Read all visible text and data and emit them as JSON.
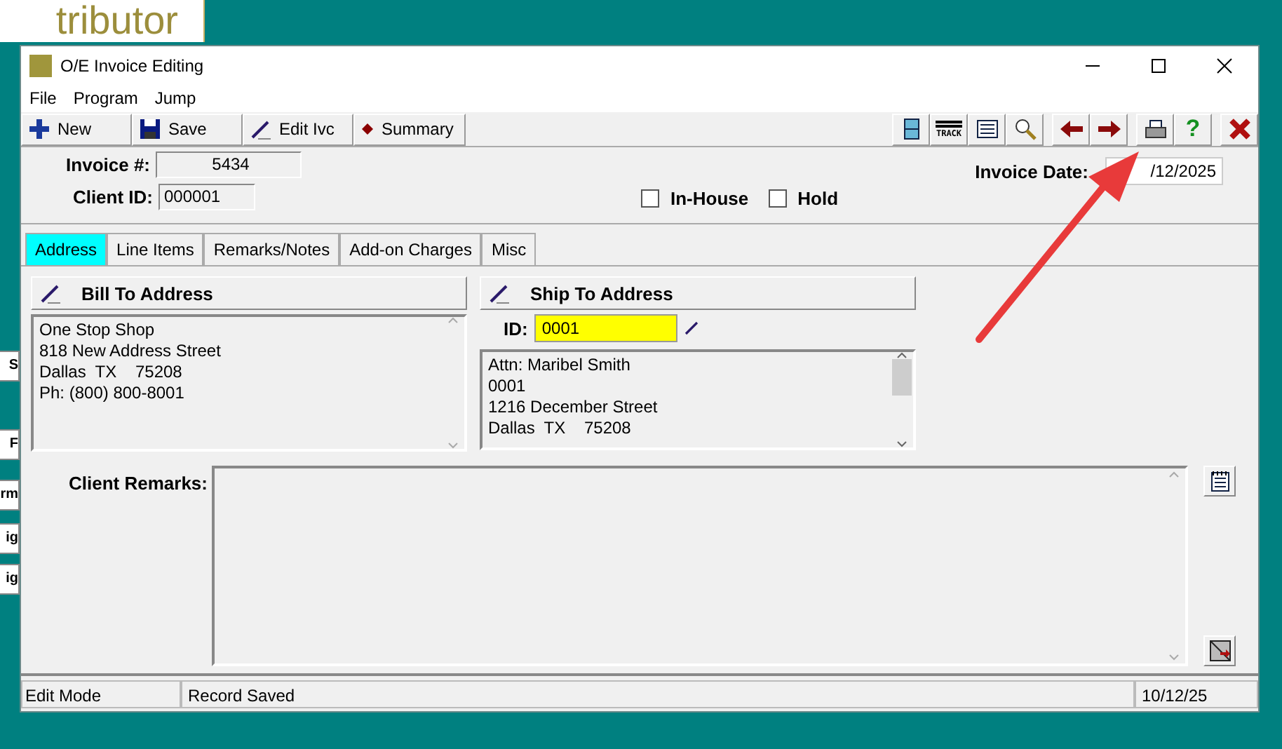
{
  "desktop": {
    "logo_text": "tributor",
    "background_buttons": [
      "S",
      "F",
      "rm",
      "ig",
      "ig"
    ]
  },
  "window": {
    "title": "O/E Invoice Editing"
  },
  "menu": [
    "File",
    "Program",
    "Jump"
  ],
  "toolbar_left": [
    {
      "label": "New",
      "kind": "new"
    },
    {
      "label": "Save",
      "kind": "save"
    },
    {
      "label": "Edit Ivc",
      "kind": "edit"
    },
    {
      "label": "Summary",
      "kind": "summary"
    }
  ],
  "toolbar_right": [
    {
      "kind": "cabinet"
    },
    {
      "kind": "track",
      "label": "TRACK"
    },
    {
      "kind": "list"
    },
    {
      "kind": "search"
    },
    {
      "kind": "back"
    },
    {
      "kind": "forward"
    },
    {
      "kind": "print"
    },
    {
      "kind": "help",
      "label": "?"
    },
    {
      "kind": "close"
    }
  ],
  "header": {
    "invoice_label": "Invoice #:",
    "invoice_value": "5434",
    "client_label": "Client ID:",
    "client_value": "000001",
    "checkboxes": [
      {
        "label": "In-House",
        "checked": false
      },
      {
        "label": "Hold",
        "checked": false
      }
    ],
    "date_label": "Invoice Date:",
    "date_value": "/12/2025"
  },
  "tabs": [
    {
      "label": "Address",
      "selected": true
    },
    {
      "label": "Line Items",
      "selected": false
    },
    {
      "label": "Remarks/Notes",
      "selected": false
    },
    {
      "label": "Add-on Charges",
      "selected": false
    },
    {
      "label": "Misc",
      "selected": false
    }
  ],
  "bill_to": {
    "title": "Bill To Address",
    "lines": [
      "One Stop Shop",
      "818 New Address Street",
      "Dallas  TX    75208",
      "Ph: (800) 800-8001"
    ]
  },
  "ship_to": {
    "title": "Ship To Address",
    "id_label": "ID:",
    "id_value": "0001",
    "lines": [
      "Attn: Maribel Smith",
      "0001",
      "1216 December Street",
      "Dallas  TX    75208"
    ]
  },
  "client_remarks": {
    "label": "Client Remarks:"
  },
  "status_bar": [
    "Edit Mode",
    "Record Saved",
    "10/12/25"
  ]
}
